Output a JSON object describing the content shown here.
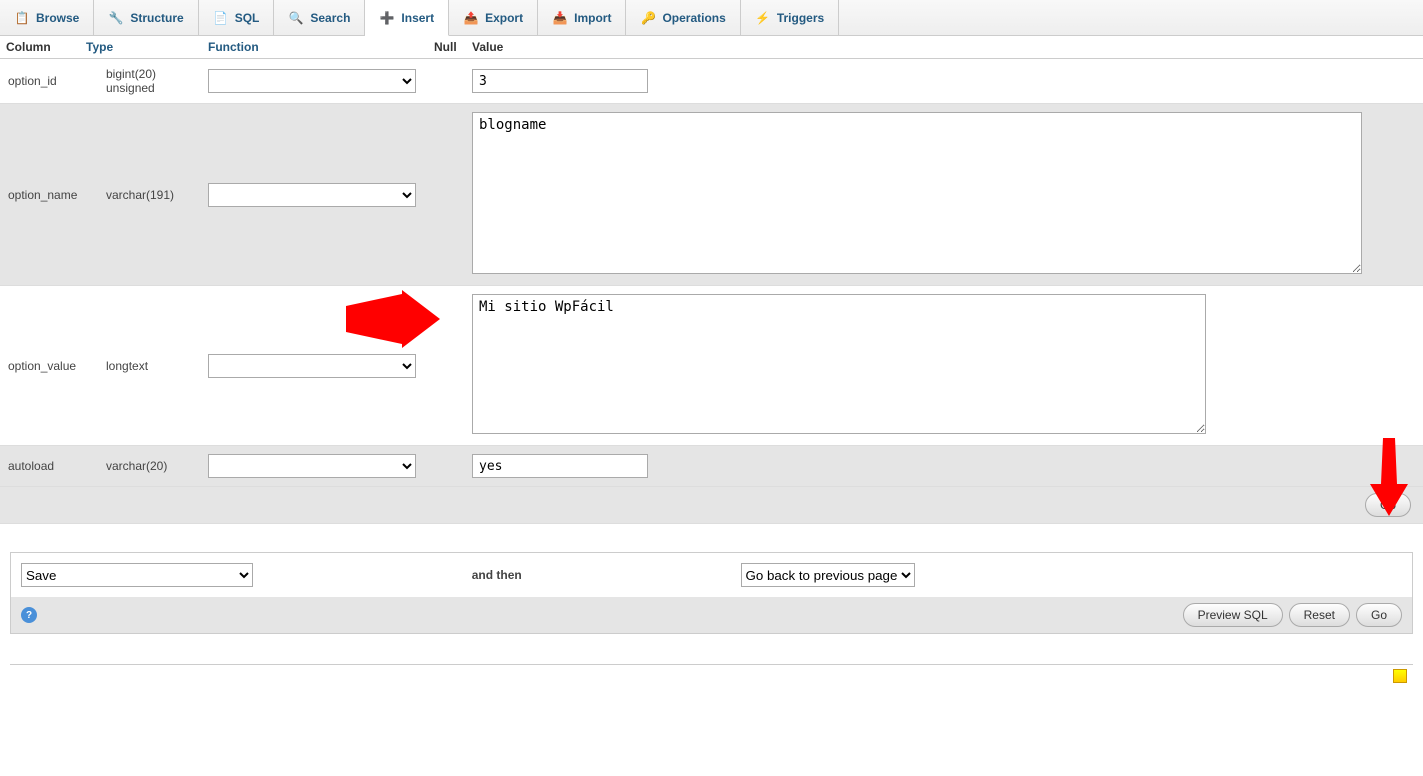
{
  "tabs": [
    {
      "label": "Browse",
      "icon": "📋"
    },
    {
      "label": "Structure",
      "icon": "🔧"
    },
    {
      "label": "SQL",
      "icon": "📄"
    },
    {
      "label": "Search",
      "icon": "🔍"
    },
    {
      "label": "Insert",
      "icon": "➕",
      "active": true
    },
    {
      "label": "Export",
      "icon": "📤"
    },
    {
      "label": "Import",
      "icon": "📥"
    },
    {
      "label": "Operations",
      "icon": "🔑"
    },
    {
      "label": "Triggers",
      "icon": "⚡"
    }
  ],
  "headers": {
    "column": "Column",
    "type": "Type",
    "function": "Function",
    "null": "Null",
    "value": "Value"
  },
  "rows": [
    {
      "col": "option_id",
      "type": "bigint(20) unsigned",
      "val": "3",
      "input": "text"
    },
    {
      "col": "option_name",
      "type": "varchar(191)",
      "val": "blogname",
      "input": "bigtextarea"
    },
    {
      "col": "option_value",
      "type": "longtext",
      "val": "Mi sitio WpFácil",
      "input": "textarea"
    },
    {
      "col": "autoload",
      "type": "varchar(20)",
      "val": "yes",
      "input": "text"
    }
  ],
  "go": "Go",
  "actions": {
    "save": "Save",
    "andthen": "and then",
    "goback": "Go back to previous page",
    "preview": "Preview SQL",
    "reset": "Reset",
    "go": "Go"
  }
}
